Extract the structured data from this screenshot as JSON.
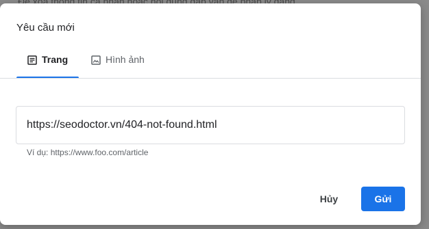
{
  "background": {
    "text": "Để xóa thông tin cá nhân hoặc nội dung gặp vấn đề pháp lý đang"
  },
  "dialog": {
    "title": "Yêu cầu mới",
    "tabs": [
      {
        "label": "Trang",
        "icon": "article-icon",
        "active": true
      },
      {
        "label": "Hình ảnh",
        "icon": "image-icon",
        "active": false
      }
    ],
    "url_input": {
      "value": "https://seodoctor.vn/404-not-found.html",
      "helper": "Ví dụ: https://www.foo.com/article"
    },
    "buttons": {
      "cancel": "Hủy",
      "send": "Gửi"
    }
  },
  "colors": {
    "accent": "#1a73e8",
    "text_primary": "#202124",
    "text_secondary": "#5f6368",
    "border": "#dadce0"
  }
}
